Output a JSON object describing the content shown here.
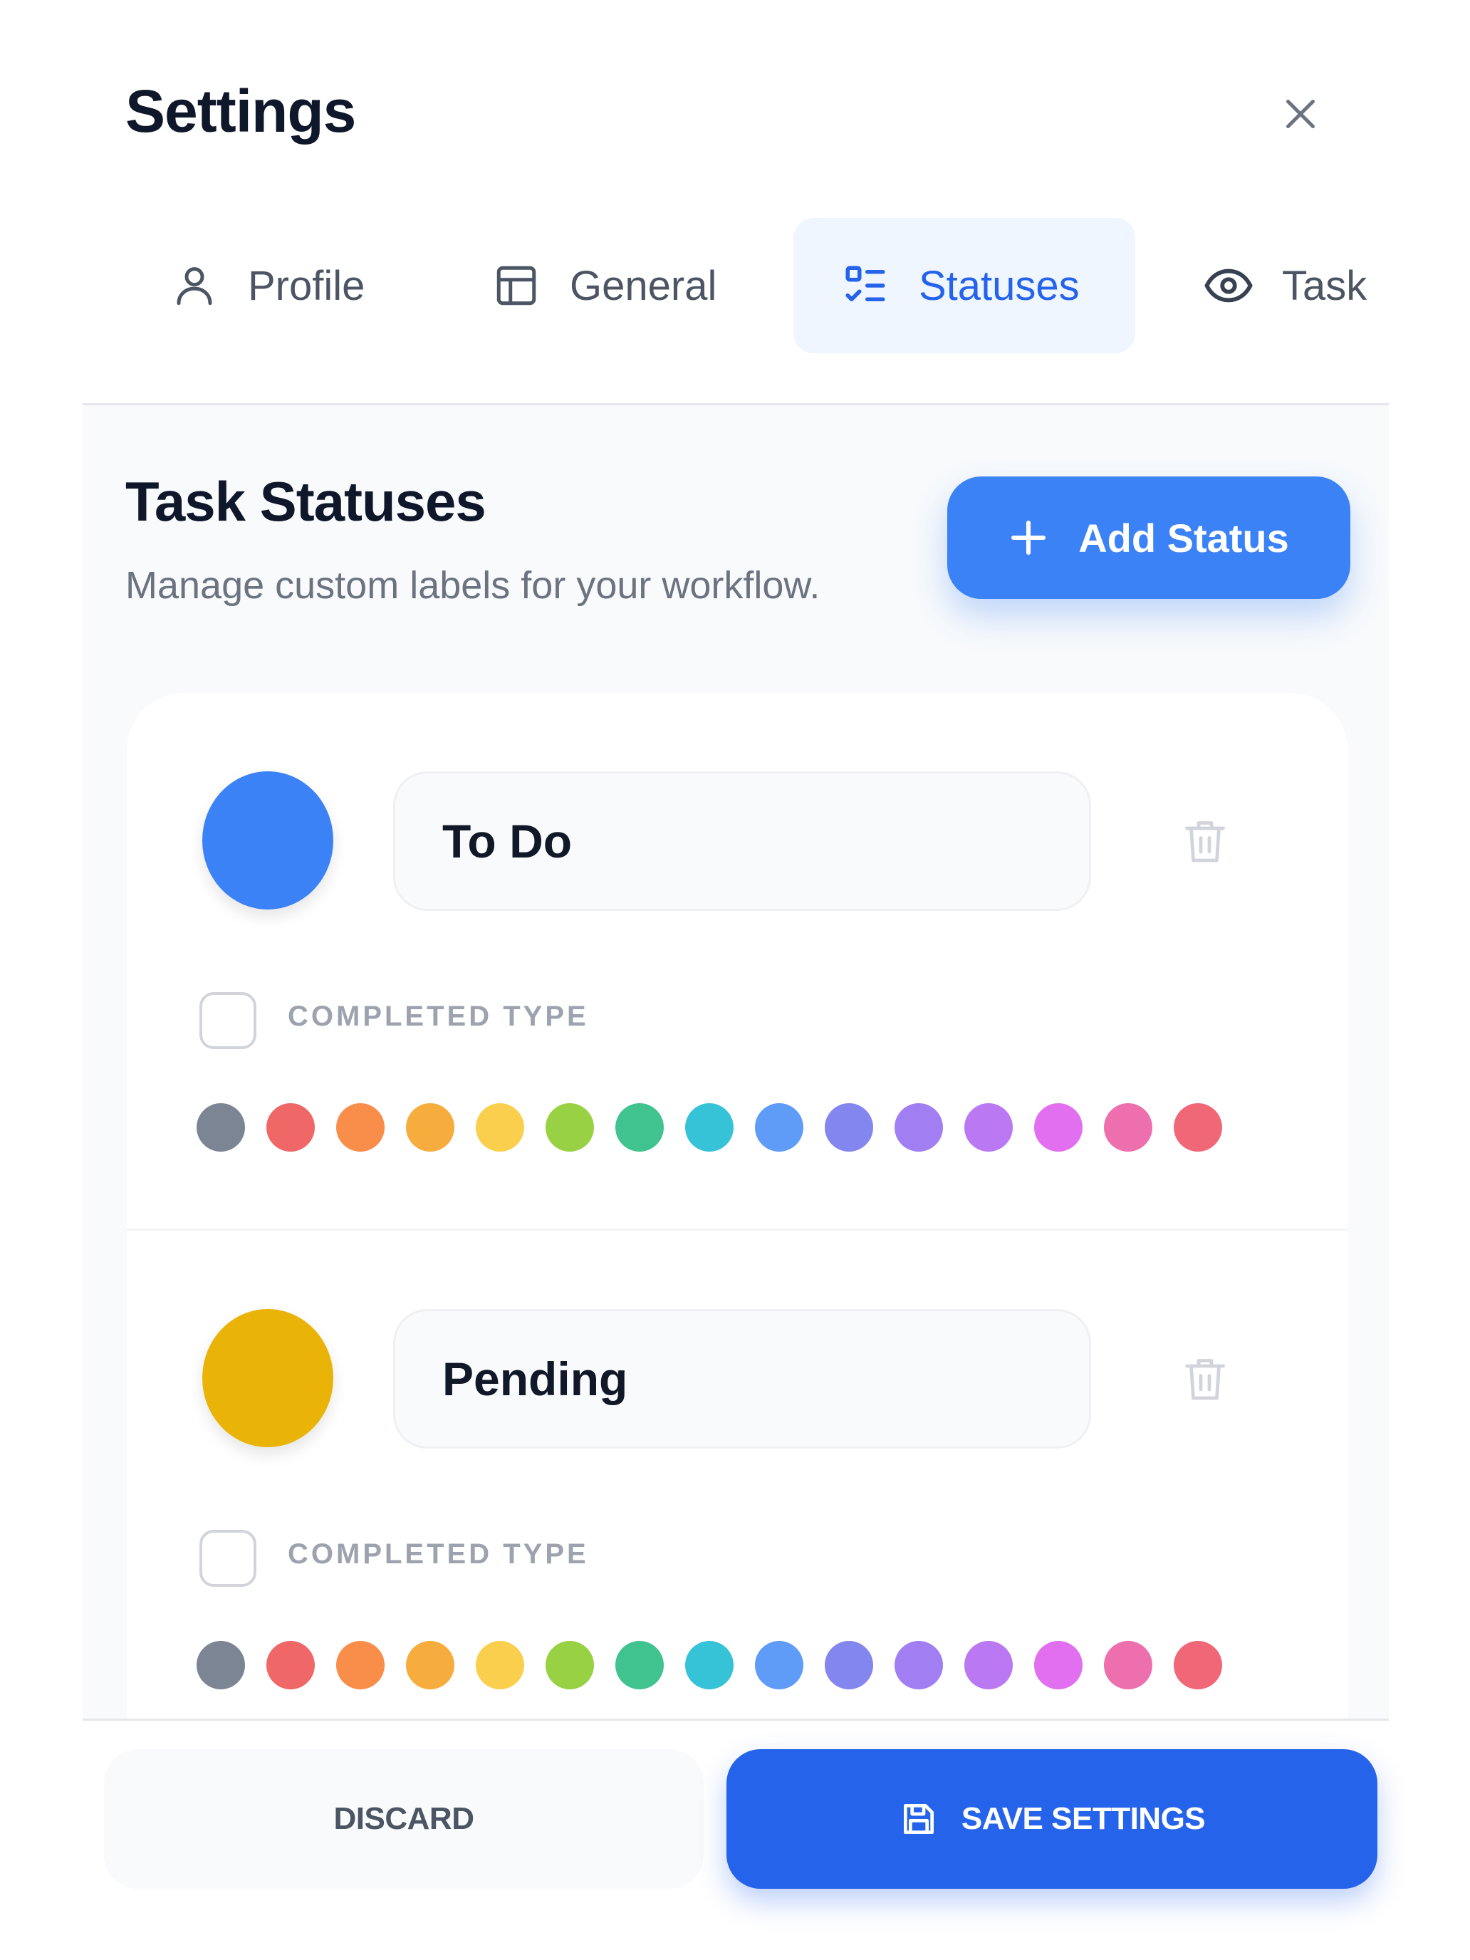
{
  "header": {
    "title": "Settings",
    "close_icon": "close-icon"
  },
  "tabs": [
    {
      "label": "Profile",
      "icon": "user-icon",
      "active": false
    },
    {
      "label": "General",
      "icon": "layout-icon",
      "active": false
    },
    {
      "label": "Statuses",
      "icon": "checklist-icon",
      "active": true
    },
    {
      "label": "Task",
      "icon": "eye-icon",
      "active": false
    }
  ],
  "section": {
    "title": "Task Statuses",
    "subtitle": "Manage custom labels for your workflow.",
    "add_button_label": "Add Status"
  },
  "statuses": [
    {
      "name": "To Do",
      "color": "#3b82f6",
      "completed_label": "COMPLETED TYPE",
      "completed": false
    },
    {
      "name": "Pending",
      "color": "#eab308",
      "completed_label": "COMPLETED TYPE",
      "completed": false
    }
  ],
  "palette": [
    "#7c8594",
    "#f06767",
    "#f98e4b",
    "#f7ad3d",
    "#fbcf4e",
    "#98d143",
    "#40c38f",
    "#36c2d7",
    "#5f9cf7",
    "#8486f0",
    "#a17ff2",
    "#bb78f3",
    "#e16ff0",
    "#ee6fad",
    "#f06878"
  ],
  "footer": {
    "discard_label": "DISCARD",
    "save_label": "SAVE SETTINGS"
  },
  "colors": {
    "accent": "#3b82f6",
    "primary": "#2563eb",
    "active_tab_bg": "#eff6ff"
  }
}
